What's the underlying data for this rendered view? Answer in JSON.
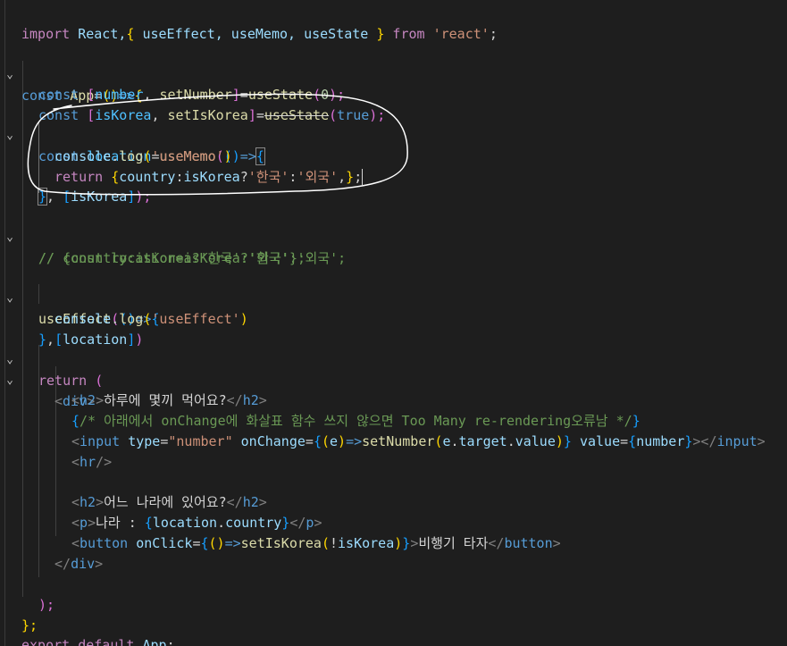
{
  "editor": {
    "language": "javascript-react",
    "theme_colors": {
      "background": "#1e1e1e",
      "keyword": "#569cd6",
      "control": "#c586c0",
      "function": "#dcdcaa",
      "variable": "#9cdcfe",
      "string": "#ce9178",
      "number": "#b5cea8",
      "comment": "#6a9955",
      "bracket_gold": "#ffd700",
      "bracket_purple": "#da70d6",
      "bracket_blue": "#179fff",
      "annotation_ink": "#ffffff"
    },
    "fold_icon": "chevron-down-icon",
    "lines": {
      "l1": [
        "import",
        " React,",
        "{",
        " useEffect, useMemo, useState ",
        "}",
        " from ",
        "'react'",
        ";"
      ],
      "l3": [
        "const",
        " ",
        "App",
        "=",
        "()",
        "=>",
        "{"
      ],
      "l4": [
        "const",
        " ",
        "[",
        "number",
        ", ",
        "setNumber",
        "]",
        "=",
        "useState",
        "(",
        "0",
        ");"
      ],
      "l5": [
        "const",
        " ",
        "[",
        "isKorea",
        ", ",
        "setIsKorea",
        "]",
        "=",
        "useState",
        "(",
        "true",
        ");"
      ],
      "l6": [
        "const",
        " ",
        "location",
        "=",
        "useMemo",
        "(",
        "()",
        "=>",
        "{"
      ],
      "l7": [
        "console",
        ".",
        "log",
        "(",
        "'useMemo'",
        ")"
      ],
      "l8": [
        "return",
        " ",
        "{",
        "country",
        ":",
        "isKorea",
        "?",
        "'한국'",
        ":",
        "'외국'",
        ",",
        "}",
        ";"
      ],
      "l9": [
        "}",
        ", ",
        "[",
        "isKorea",
        "]",
        ");"
      ],
      "l10": "// {country:isKorea?'한국':'외국'};",
      "l11": "// const location=isKorea?'한국':'외국';",
      "l13": [
        "useEffect",
        "(",
        "()",
        "=>",
        "{"
      ],
      "l14": [
        "console",
        ".",
        "log",
        "(",
        "'useEffect'",
        ")"
      ],
      "l15": [
        "}",
        ",",
        "[",
        "location",
        "]",
        ")"
      ],
      "l16": [
        "return",
        " ",
        "("
      ],
      "l17": [
        "<",
        "div",
        ">"
      ],
      "l18": [
        "<",
        "h2",
        ">",
        "하루에 몇끼 먹어요?",
        "</",
        "h2",
        ">"
      ],
      "l19": [
        "{",
        "/* 아래에서 onChange에 화살표 함수 쓰지 않으면 Too Many re-rendering오류남 */",
        "}"
      ],
      "l20": [
        "<",
        "input",
        " ",
        "type",
        "=",
        "\"number\"",
        " ",
        "onChange",
        "=",
        "{",
        "(",
        "e",
        ")",
        "=>",
        "setNumber",
        "(",
        "e",
        ".",
        "target",
        ".",
        "value",
        ")",
        "}",
        " ",
        "value",
        "=",
        "{",
        "number",
        "}",
        "></",
        "input",
        ">"
      ],
      "l21": [
        "<",
        "hr",
        "/>"
      ],
      "l23": [
        "<",
        "h2",
        ">",
        "어느 나라에 있어요?",
        "</",
        "h2",
        ">"
      ],
      "l24": [
        "<",
        "p",
        ">",
        "나라 : ",
        "{",
        "location",
        ".",
        "country",
        "}",
        "</",
        "p",
        ">"
      ],
      "l25": [
        "<",
        "button",
        " ",
        "onClick",
        "=",
        "{",
        "()",
        "=>",
        "setIsKorea",
        "(",
        "!",
        "isKorea",
        ")",
        "}",
        ">",
        "비행기 타자",
        "</",
        "button",
        ">"
      ],
      "l26": [
        "</",
        "div",
        ">"
      ],
      "l28": [
        ");"
      ],
      "l29": [
        "};"
      ],
      "l30": [
        "export",
        " ",
        "default",
        " ",
        "App",
        ";"
      ]
    }
  }
}
